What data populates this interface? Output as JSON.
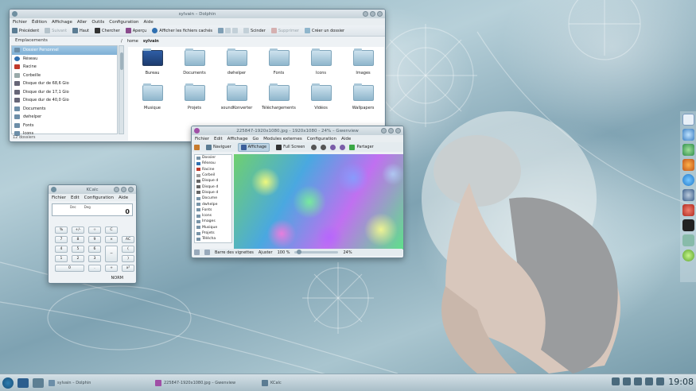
{
  "dolphin": {
    "title": "sylvain – Dolphin",
    "menu": [
      "Fichier",
      "Édition",
      "Affichage",
      "Aller",
      "Outils",
      "Configuration",
      "Aide"
    ],
    "toolbar": {
      "back": "Précédent",
      "forward": "Suivant",
      "up": "Haut",
      "search": "Chercher",
      "preview": "Aperçu",
      "hidden": "Afficher les fichiers cachés",
      "split": "Scinder",
      "delete": "Supprimer",
      "newfolder": "Créer un dossier"
    },
    "places_title": "Emplacements",
    "places": [
      "Dossier Personnel",
      "Réseau",
      "Racine",
      "Corbeille",
      "Disque dur de 68,6 Gio",
      "Disque dur de 17,1 Gio",
      "Disque dur de 40,0 Gio",
      "Documents",
      "dwhelper",
      "Fonts",
      "Icons"
    ],
    "breadcrumb": [
      "/",
      "home",
      "sylvain"
    ],
    "files": [
      "Bureau",
      "Documents",
      "dwhelper",
      "Fonts",
      "Icons",
      "Images",
      "Musique",
      "Projets",
      "soundKonverter",
      "Téléchargements",
      "Vidéos",
      "Wallpapers"
    ],
    "status": "12 dossiers"
  },
  "gwenview": {
    "title": "225847-1920x1080.jpg - 1920x1080 - 24% – Gwenview",
    "menu": [
      "Fichier",
      "Edit",
      "Affichage",
      "Go",
      "Modules externes",
      "Configuration",
      "Aide"
    ],
    "toolbar": {
      "browse": "Naviguer",
      "view": "Affichage",
      "fullscreen": "Full Screen",
      "share": "Partager"
    },
    "tree": [
      "Dossier",
      "Réseau",
      "Racine",
      "Corbeil",
      "Disque d",
      "Disque d",
      "Disque d",
      "Docume",
      "dwhelpe",
      "Fonts",
      "Icons",
      "Images",
      "Musique",
      "Projets",
      "Télécha"
    ],
    "status": {
      "thumbbar": "Barre des vignettes",
      "fit": "Ajuster",
      "zoom100": "100 %",
      "zoom": "24%"
    }
  },
  "kcalc": {
    "title": "KCalc",
    "menu": [
      "Fichier",
      "Edit",
      "Configuration",
      "Aide"
    ],
    "display_labels": [
      "Dec",
      "Deg"
    ],
    "display_value": "0",
    "keys": [
      "%",
      "+/-",
      "÷",
      "C",
      "7",
      "8",
      "9",
      "×",
      "AC",
      "4",
      "5",
      "6",
      "−",
      "(",
      "1",
      "2",
      "3",
      "+",
      ")",
      "0",
      ".",
      "=",
      "x²"
    ],
    "mode": "NORM"
  },
  "taskbar": {
    "tasks": [
      "sylvain – Dolphin",
      "225847-1920x1080.jpg – Gwenview",
      "KCalc"
    ],
    "clock": "19:08"
  }
}
